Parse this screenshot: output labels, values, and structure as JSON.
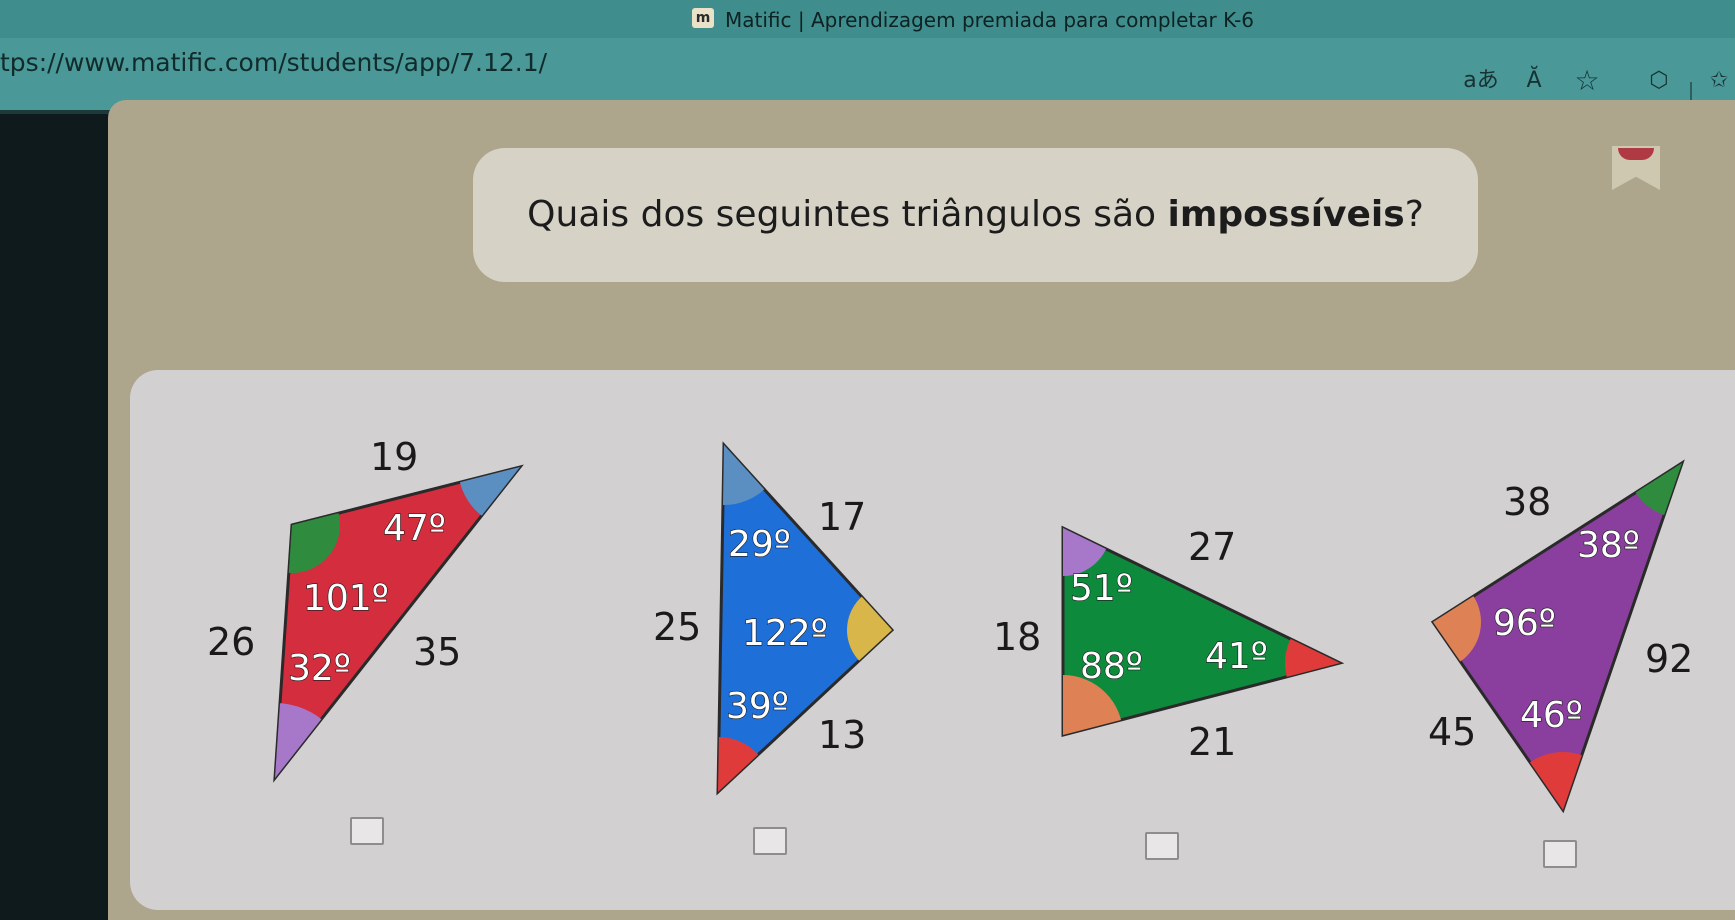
{
  "browser": {
    "tab_title": "Matific | Aprendizagem premiada para completar K-6",
    "app_icon_glyph": "m",
    "url": "tps://www.matific.com/students/app/7.12.1/",
    "icons": [
      "translate-icon",
      "read-aloud-icon",
      "favorite-star-icon",
      "extensions-icon",
      "favorites-bar-icon"
    ],
    "translate_glyph": "aあ",
    "read_aloud_glyph": "Ă",
    "star_glyph": "☆",
    "extensions_glyph": "⬡",
    "favorites_glyph": "✩"
  },
  "question": {
    "prefix": "Quais dos seguintes triângulos são ",
    "emphasis": "impossíveis",
    "suffix": "?"
  },
  "triangles": [
    {
      "color": "#d32d3e",
      "sides": [
        "19",
        "26",
        "35"
      ],
      "angles": [
        "47º",
        "101º",
        "32º"
      ]
    },
    {
      "color": "#1f6fd9",
      "sides": [
        "17",
        "25",
        "13"
      ],
      "angles": [
        "29º",
        "122º",
        "39º"
      ]
    },
    {
      "color": "#0e8a3c",
      "sides": [
        "27",
        "18",
        "21"
      ],
      "angles": [
        "51º",
        "88º",
        "41º"
      ]
    },
    {
      "color": "#8a3f9e",
      "sides": [
        "38",
        "92",
        "45"
      ],
      "angles": [
        "38º",
        "96º",
        "46º"
      ]
    }
  ],
  "colors": {
    "angle_green": "#2f8c3f",
    "angle_blue": "#5b8fc2",
    "angle_purple": "#a777c9",
    "angle_yellow": "#d8b64a",
    "angle_red": "#e03b3b",
    "angle_orange": "#de8255"
  }
}
